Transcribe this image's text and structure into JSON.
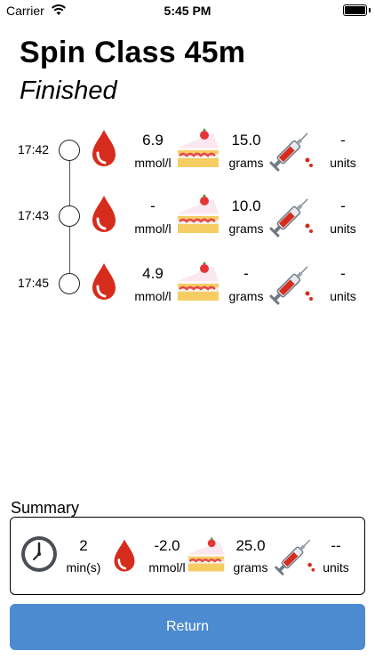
{
  "status_bar": {
    "carrier": "Carrier",
    "time": "5:45 PM"
  },
  "header": {
    "title": "Spin Class 45m",
    "subtitle": "Finished"
  },
  "entries": [
    {
      "time": "17:42",
      "glucose": "6.9",
      "glucose_unit": "mmol/l",
      "carbs": "15.0",
      "carbs_unit": "grams",
      "insulin": "-",
      "insulin_unit": "units"
    },
    {
      "time": "17:43",
      "glucose": "-",
      "glucose_unit": "mmol/l",
      "carbs": "10.0",
      "carbs_unit": "grams",
      "insulin": "-",
      "insulin_unit": "units"
    },
    {
      "time": "17:45",
      "glucose": "4.9",
      "glucose_unit": "mmol/l",
      "carbs": "-",
      "carbs_unit": "grams",
      "insulin": "-",
      "insulin_unit": "units"
    }
  ],
  "summary": {
    "label": "Summary",
    "duration": "2",
    "duration_unit": "min(s)",
    "glucose": "-2.0",
    "glucose_unit": "mmol/l",
    "carbs": "25.0",
    "carbs_unit": "grams",
    "insulin": "--",
    "insulin_unit": "units"
  },
  "actions": {
    "return_label": "Return"
  },
  "colors": {
    "accent": "#4d8bd0",
    "blood": "#d62c1e"
  },
  "icons": [
    "wifi-icon",
    "battery-icon",
    "blood-drop-icon",
    "cake-icon",
    "syringe-icon",
    "clock-icon"
  ]
}
